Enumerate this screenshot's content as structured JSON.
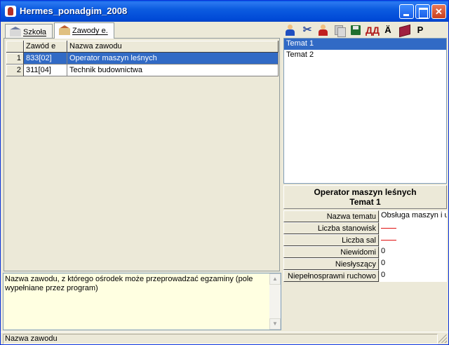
{
  "window": {
    "title": "Hermes_ponadgim_2008"
  },
  "tabs": [
    {
      "label": "Szkoła",
      "active": false,
      "icon": "school-icon"
    },
    {
      "label": "Zawody e.",
      "active": true,
      "icon": "building-icon"
    }
  ],
  "grid": {
    "columns": [
      "",
      "Zawód e",
      "Nazwa zawodu"
    ],
    "rows": [
      {
        "num": "1",
        "code": "833[02]",
        "name": "Operator maszyn leśnych",
        "selected": true
      },
      {
        "num": "2",
        "code": "311[04]",
        "name": "Technik budownictwa",
        "selected": false
      }
    ]
  },
  "toolbar": {
    "icons": [
      "users-icon",
      "cut-icon",
      "users-red-icon",
      "copy-icon",
      "save-icon",
      "binoculars-icon",
      "a-umlaut-icon",
      "book-icon",
      "p-icon"
    ],
    "find_glyph": "ДД",
    "a_glyph": "Ä",
    "p_glyph": "P"
  },
  "topics": [
    {
      "label": "Temat 1",
      "selected": true
    },
    {
      "label": "Temat 2",
      "selected": false
    }
  ],
  "info": {
    "title": "Operator maszyn leśnych",
    "subtitle": "Temat 1"
  },
  "props": [
    {
      "label": "Nazwa tematu",
      "value": "Obsługa maszyn i u"
    },
    {
      "label": "Liczba stanowisk",
      "value": ""
    },
    {
      "label": "Liczba sal",
      "value": ""
    },
    {
      "label": "Niewidomi",
      "value": "0"
    },
    {
      "label": "Niesłyszący",
      "value": "0"
    },
    {
      "label": "Niepełnosprawni ruchowo",
      "value": "0"
    }
  ],
  "help": {
    "text": "Nazwa zawodu, z którego ośrodek może przeprowadzać egzaminy (pole wypełniane przez program)"
  },
  "status": {
    "text": "Nazwa zawodu"
  }
}
